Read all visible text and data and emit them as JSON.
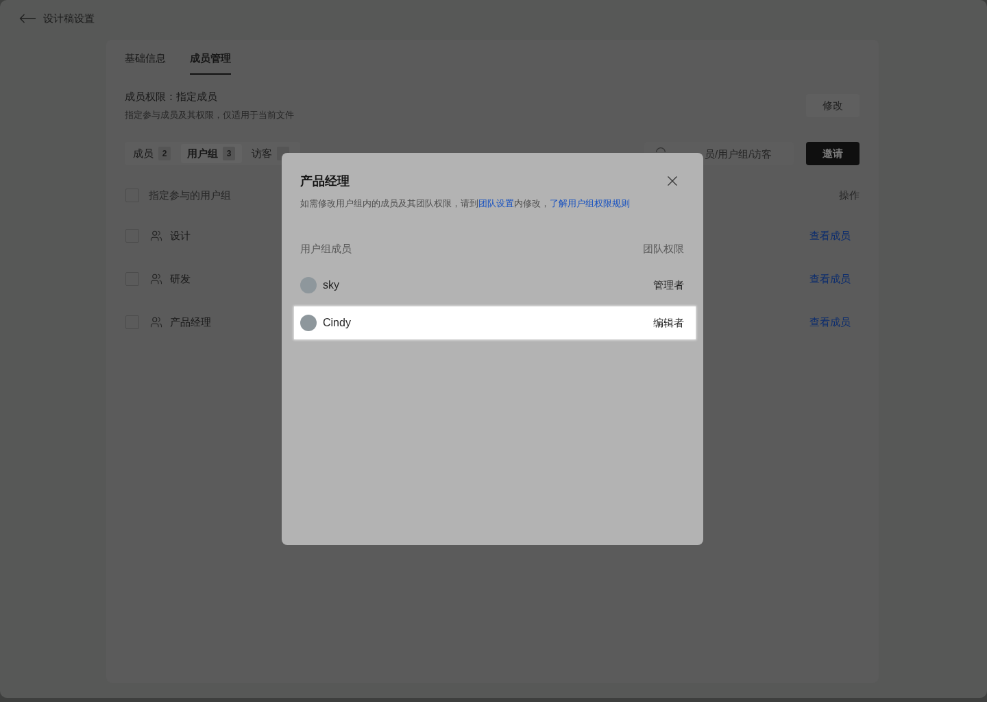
{
  "header": {
    "title": "设计稿设置"
  },
  "tabs": [
    {
      "label": "基础信息",
      "selected": false
    },
    {
      "label": "成员管理",
      "selected": true
    }
  ],
  "permission": {
    "title": "成员权限：指定成员",
    "description": "指定参与成员及其权限，仅适用于当前文件",
    "edit_button": "修改"
  },
  "filter_tabs": [
    {
      "label": "成员",
      "count": "2",
      "selected": false
    },
    {
      "label": "用户组",
      "count": "3",
      "selected": true
    },
    {
      "label": "访客",
      "selected": false
    }
  ],
  "search": {
    "placeholder": "员/用户组/访客"
  },
  "invite_button": "邀请",
  "group_table": {
    "select_all": {
      "label": "指定参与的用户组",
      "checked": false
    },
    "action_header": "操作",
    "rows": [
      {
        "name": "设计",
        "checked": false,
        "action": "查看成员"
      },
      {
        "name": "研发",
        "checked": false,
        "action": "查看成员"
      },
      {
        "name": "产品经理",
        "checked": false,
        "action": "查看成员"
      }
    ]
  },
  "modal": {
    "title": "产品经理",
    "description": [
      {
        "kind": "text",
        "text": "如需修改用户组内的成员及其团队权限，请到"
      },
      {
        "kind": "link",
        "text": "团队设置"
      },
      {
        "kind": "text",
        "text": "内修改，"
      },
      {
        "kind": "link",
        "text": "了解用户组权限规则"
      }
    ],
    "columns": [
      "用户组成员",
      "团队权限"
    ],
    "members": [
      {
        "name": "sky",
        "role": "管理者",
        "highlighted": false
      },
      {
        "name": "Cindy",
        "role": "编辑者",
        "highlighted": true
      }
    ]
  }
}
